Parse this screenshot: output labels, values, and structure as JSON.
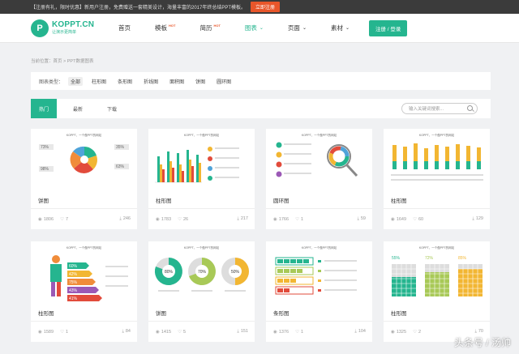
{
  "promo": {
    "text": "【注册有礼，限时优惠】新用户注册，免费赠送一套精美设计，海量丰富的2017年终总结PPT模板。",
    "cta": "立即注册"
  },
  "logo": {
    "mark": "P",
    "title": "KOPPT.CN",
    "subtitle": "让演示更简单"
  },
  "nav": {
    "items": [
      {
        "label": "首页",
        "badge": "",
        "caret": ""
      },
      {
        "label": "模板",
        "badge": "HOT",
        "caret": ""
      },
      {
        "label": "简历",
        "badge": "HOT",
        "caret": ""
      },
      {
        "label": "图表",
        "badge": "",
        "caret": "⌄"
      },
      {
        "label": "页面",
        "badge": "",
        "caret": "⌄"
      },
      {
        "label": "素材",
        "badge": "",
        "caret": "⌄"
      }
    ],
    "login": "注册 / 登录"
  },
  "breadcrumb": "当前位置：首页 > PPT数据图表",
  "filter": {
    "label": "图表类型：",
    "options": [
      "全部",
      "柱形图",
      "条形图",
      "折线图",
      "面积图",
      "饼图",
      "圆环图"
    ]
  },
  "tabs": [
    "热门",
    "最新",
    "下载"
  ],
  "search": {
    "placeholder": "输入关键词搜索..."
  },
  "cards": [
    {
      "title": "饼图",
      "views": "1806",
      "likes": "7",
      "downloads": "246"
    },
    {
      "title": "柱形图",
      "views": "1783",
      "likes": "26",
      "downloads": "217"
    },
    {
      "title": "圆环图",
      "views": "1766",
      "likes": "1",
      "downloads": "59"
    },
    {
      "title": "柱形图",
      "views": "1649",
      "likes": "60",
      "downloads": "129"
    },
    {
      "title": "柱形图",
      "views": "1589",
      "likes": "1",
      "downloads": "84"
    },
    {
      "title": "饼图",
      "views": "1415",
      "likes": "5",
      "downloads": "151"
    },
    {
      "title": "条形图",
      "views": "1376",
      "likes": "1",
      "downloads": "104"
    },
    {
      "title": "柱形图",
      "views": "1325",
      "likes": "2",
      "downloads": "70"
    }
  ],
  "thumbs": {
    "t1": {
      "pct": [
        "73%",
        "35%",
        "98%",
        "63%"
      ]
    },
    "t5": {
      "pct": [
        "60%",
        "42%",
        "75%",
        "43%",
        "41%"
      ]
    },
    "t6": {
      "pct": [
        "80%",
        "70%",
        "50%"
      ]
    },
    "t8": {
      "pct": [
        "55%",
        "72%",
        "85%"
      ]
    },
    "mini_title": "KOPPT，一个做PPT的网站"
  },
  "watermark": "头条号 / 汤帅",
  "colors": {
    "accent": "#25b58f",
    "promo_cta": "#e8562a"
  }
}
